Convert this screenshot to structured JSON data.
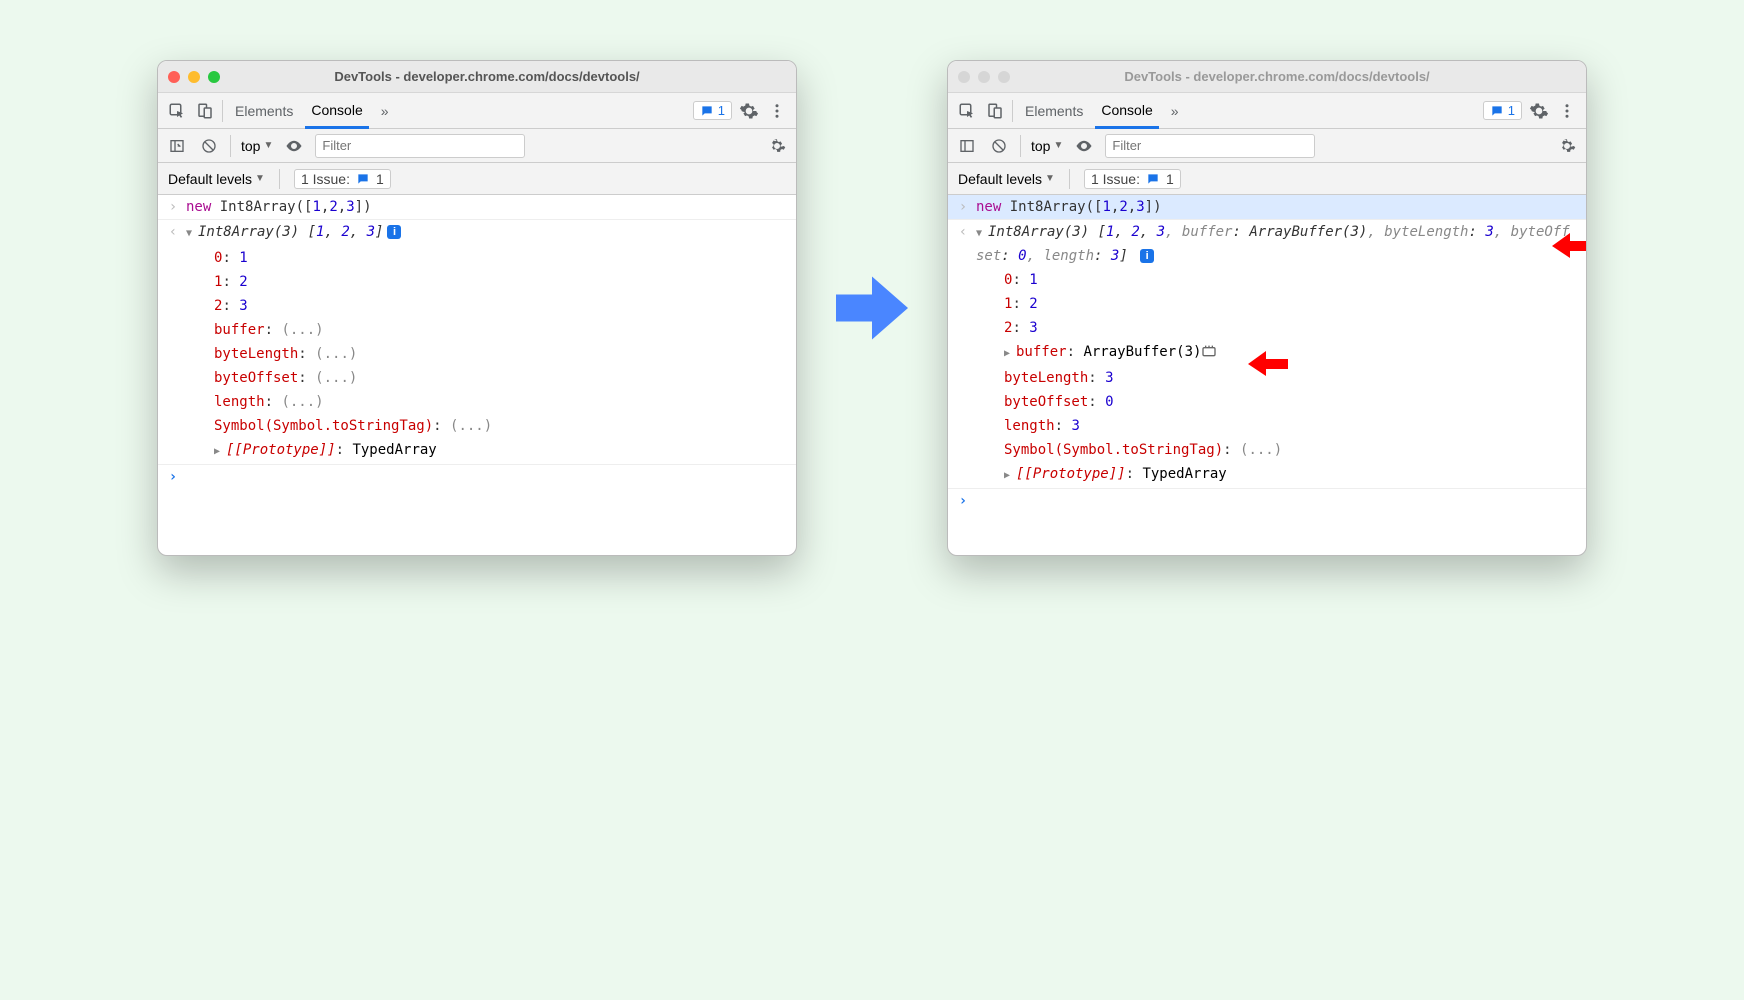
{
  "window_title": "DevTools - developer.chrome.com/docs/devtools/",
  "tabs": {
    "elements": "Elements",
    "console": "Console",
    "more": "»"
  },
  "badge_count": "1",
  "consbar": {
    "context": "top",
    "filter_placeholder": "Filter"
  },
  "filterbar": {
    "levels": "Default levels",
    "issues_label": "1 Issue:",
    "issues_count": "1"
  },
  "input_code": "new Int8Array([1,2,3])",
  "left": {
    "summary": "Int8Array(3) [1, 2, 3]",
    "entries": [
      {
        "k": "0",
        "v": "1"
      },
      {
        "k": "1",
        "v": "2"
      },
      {
        "k": "2",
        "v": "3"
      }
    ],
    "lazy": [
      "buffer: (...)",
      "byteLength: (...)",
      "byteOffset: (...)",
      "length: (...)",
      "Symbol(Symbol.toStringTag): (...)"
    ],
    "proto": "[[Prototype]]: TypedArray"
  },
  "right": {
    "summary_pre": "Int8Array(3) [",
    "summary_items": "1, 2, 3",
    "summary_tail": ", buffer: ArrayBuffer(3), byteLength: 3, byteOffset: 0, length: 3]",
    "entries": [
      {
        "k": "0",
        "v": "1"
      },
      {
        "k": "1",
        "v": "2"
      },
      {
        "k": "2",
        "v": "3"
      }
    ],
    "buffer_label": "buffer",
    "buffer_value": "ArrayBuffer(3)",
    "props": [
      {
        "k": "byteLength",
        "v": "3"
      },
      {
        "k": "byteOffset",
        "v": "0"
      },
      {
        "k": "length",
        "v": "3"
      }
    ],
    "symbol": "Symbol(Symbol.toStringTag): (...)",
    "proto": "[[Prototype]]: TypedArray"
  }
}
